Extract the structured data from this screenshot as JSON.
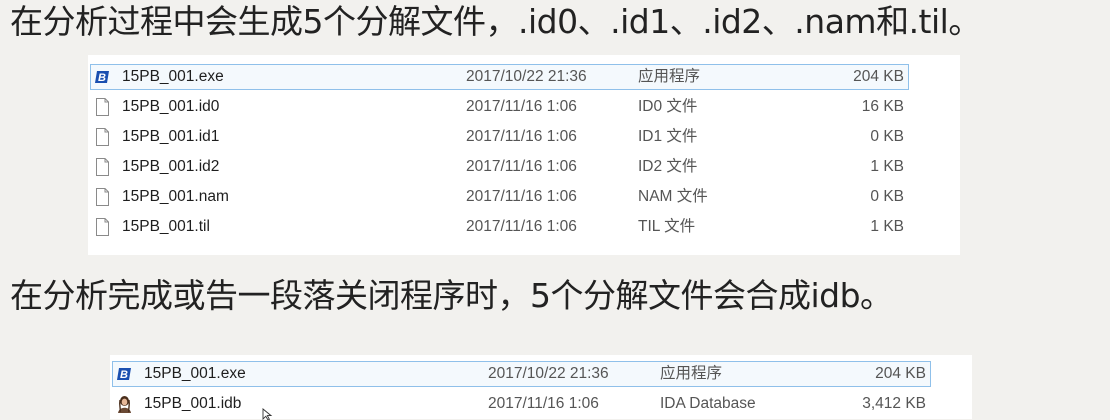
{
  "headings": {
    "top": "在分析过程中会生成5个分解文件，.id0、.id1、.id2、.nam和.til。",
    "middle": "在分析完成或告一段落关闭程序时，5个分解文件会合成idb。"
  },
  "panel1": {
    "files": [
      {
        "name": "15PB_001.exe",
        "date": "2017/10/22 21:36",
        "type": "应用程序",
        "size": "204 KB",
        "icon": "exe-app-icon",
        "selected": true
      },
      {
        "name": "15PB_001.id0",
        "date": "2017/11/16 1:06",
        "type": "ID0 文件",
        "size": "16 KB",
        "icon": "file-icon",
        "selected": false
      },
      {
        "name": "15PB_001.id1",
        "date": "2017/11/16 1:06",
        "type": "ID1 文件",
        "size": "0 KB",
        "icon": "file-icon",
        "selected": false
      },
      {
        "name": "15PB_001.id2",
        "date": "2017/11/16 1:06",
        "type": "ID2 文件",
        "size": "1 KB",
        "icon": "file-icon",
        "selected": false
      },
      {
        "name": "15PB_001.nam",
        "date": "2017/11/16 1:06",
        "type": "NAM 文件",
        "size": "0 KB",
        "icon": "file-icon",
        "selected": false
      },
      {
        "name": "15PB_001.til",
        "date": "2017/11/16 1:06",
        "type": "TIL 文件",
        "size": "1 KB",
        "icon": "file-icon",
        "selected": false
      }
    ]
  },
  "panel2": {
    "files": [
      {
        "name": "15PB_001.exe",
        "date": "2017/10/22 21:36",
        "type": "应用程序",
        "size": "204 KB",
        "icon": "exe-app-icon",
        "selected": true
      },
      {
        "name": "15PB_001.idb",
        "date": "2017/11/16 1:06",
        "type": "IDA Database",
        "size": "3,412 KB",
        "icon": "ida-database-icon",
        "selected": false
      }
    ]
  },
  "colors": {
    "background": "#f2f1ee",
    "selection_border": "#8fc0ea",
    "exe_icon_blue": "#1a4fb0"
  }
}
